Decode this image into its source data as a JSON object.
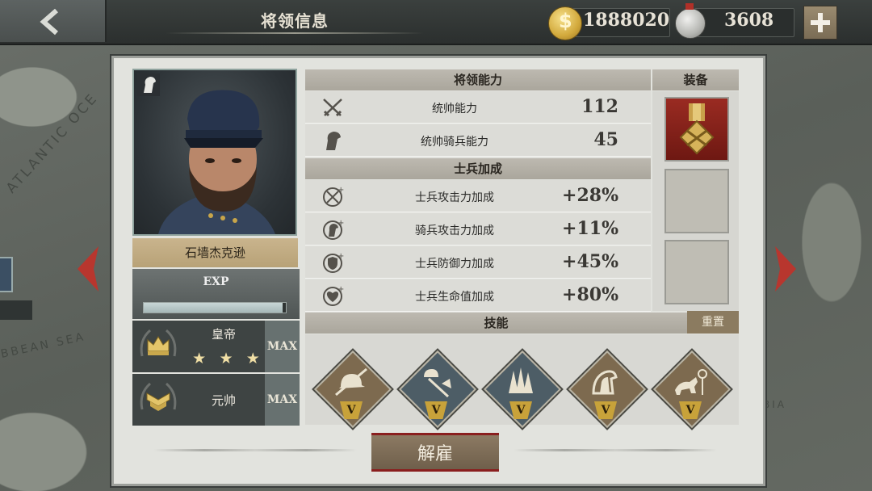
{
  "header": {
    "title": "将领信息",
    "gold": "1888020",
    "medals": "3608"
  },
  "map": {
    "labels": [
      "ATLANTIC OCE",
      "BBEAN SEA",
      "BIA"
    ]
  },
  "general": {
    "name": "石墙杰克逊",
    "exp_label": "EXP",
    "exp_progress": 0.98,
    "ranks": [
      {
        "name": "皇帝",
        "stars": 3,
        "max_label": "MAX"
      },
      {
        "name": "元帅",
        "max_label": "MAX"
      }
    ]
  },
  "abilities": {
    "header": "将领能力",
    "rows": [
      {
        "icon": "crossed-swords-icon",
        "label": "统帅能力",
        "value": "112"
      },
      {
        "icon": "horse-head-icon",
        "label": "统帅骑兵能力",
        "value": "45"
      }
    ]
  },
  "soldier_bonus": {
    "header": "士兵加成",
    "rows": [
      {
        "icon": "sword-plus-icon",
        "label": "士兵攻击力加成",
        "value": "+28%"
      },
      {
        "icon": "horse-plus-icon",
        "label": "骑兵攻击力加成",
        "value": "+11%"
      },
      {
        "icon": "shield-plus-icon",
        "label": "士兵防御力加成",
        "value": "+45%"
      },
      {
        "icon": "heart-plus-icon",
        "label": "士兵生命值加成",
        "value": "+80%"
      }
    ]
  },
  "equipment": {
    "header": "装备",
    "slots": [
      "medal-icon",
      "empty",
      "empty"
    ]
  },
  "skills": {
    "header": "技能",
    "reset_label": "重置",
    "items": [
      {
        "icon": "infantry-helmet-icon",
        "level": "V",
        "color": "#7d6a4f"
      },
      {
        "icon": "axe-helmet-icon",
        "level": "V",
        "color": "#4d5d66"
      },
      {
        "icon": "trees-icon",
        "level": "V",
        "color": "#4d5d66"
      },
      {
        "icon": "knight-horse-icon",
        "level": "V",
        "color": "#7d6a4f"
      },
      {
        "icon": "cavalry-charge-icon",
        "level": "V",
        "color": "#7d6a4f"
      }
    ]
  },
  "actions": {
    "dismiss_label": "解雇"
  }
}
